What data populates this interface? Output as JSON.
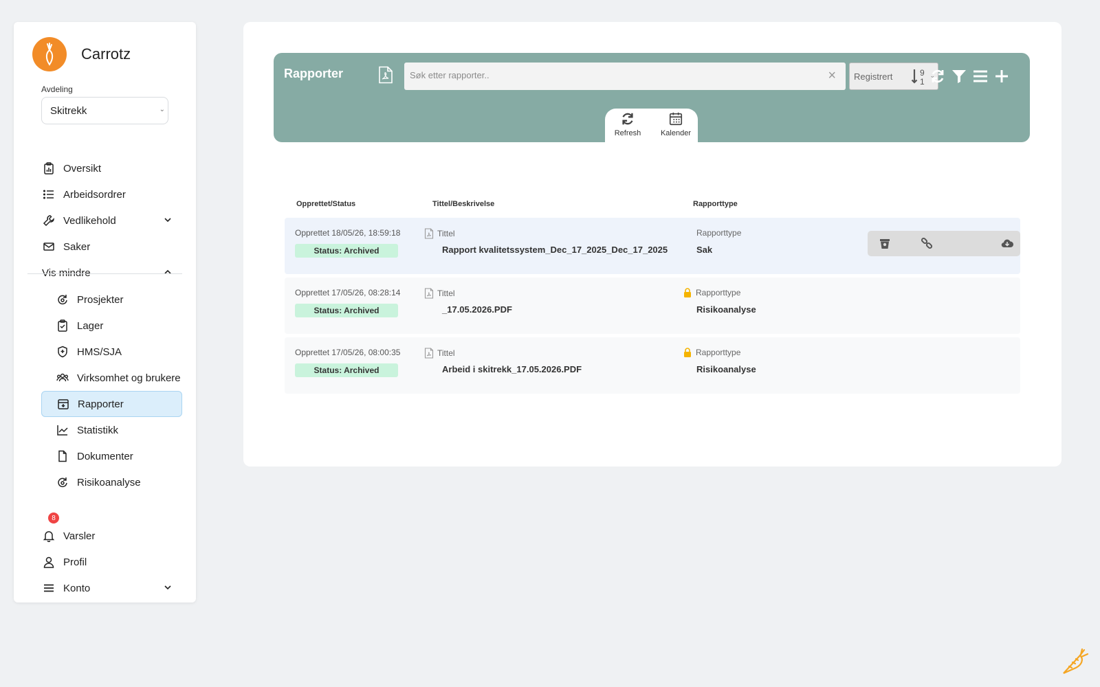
{
  "app": {
    "brand_name": "Carrotz"
  },
  "sidebar": {
    "department_label": "Avdeling",
    "department_value": "Skitrekk",
    "nav": [
      {
        "label": "Oversikt",
        "icon": "clipboard-chart-icon"
      },
      {
        "label": "Arbeidsordrer",
        "icon": "list-icon"
      },
      {
        "label": "Vedlikehold",
        "icon": "wrench-icon"
      },
      {
        "label": "Saker",
        "icon": "mail-icon"
      },
      {
        "label": "Vis mindre",
        "icon": "chevron-up-icon"
      }
    ],
    "sub_nav": [
      {
        "label": "Prosjekter",
        "icon": "project-cycle-icon"
      },
      {
        "label": "Lager",
        "icon": "clipboard-check-icon"
      },
      {
        "label": "HMS/SJA",
        "icon": "shield-plus-icon"
      },
      {
        "label": "Virksomhet og brukere",
        "icon": "users-icon"
      },
      {
        "label": "Rapporter",
        "icon": "inbox-download-icon"
      },
      {
        "label": "Statistikk",
        "icon": "line-chart-icon"
      },
      {
        "label": "Dokumenter",
        "icon": "document-icon"
      },
      {
        "label": "Risikoanalyse",
        "icon": "risk-cycle-icon"
      }
    ],
    "bottom_nav": [
      {
        "label": "Varsler",
        "icon": "bell-icon"
      },
      {
        "label": "Profil",
        "icon": "user-icon"
      },
      {
        "label": "Konto",
        "icon": "menu-icon"
      }
    ],
    "notification_count": "8"
  },
  "header": {
    "title": "Rapporter",
    "search_placeholder": "Søk etter rapporter..",
    "clear_symbol": "×",
    "sort_label": "Registrert",
    "sort_top": "9",
    "sort_bottom": "1",
    "tabs": [
      {
        "label": "Refresh"
      },
      {
        "label": "Kalender"
      }
    ]
  },
  "table": {
    "columns": [
      "Opprettet/Status",
      "Tittel/Beskrivelse",
      "Rapporttype"
    ],
    "rows": [
      {
        "created": "Opprettet 18/05/26, 18:59:18",
        "status": "Status: Archived",
        "title_label": "Tittel",
        "title": "Rapport kvalitetssystem_Dec_17_2025_Dec_17_2025",
        "type_label": "Rapporttype",
        "type": "Sak"
      },
      {
        "created": "Opprettet 17/05/26, 08:28:14",
        "status": "Status: Archived",
        "title_label": "Tittel",
        "title": "_17.05.2026.PDF",
        "type_label": "Rapporttype",
        "type": "Risikoanalyse"
      },
      {
        "created": "Opprettet 17/05/26, 08:00:35",
        "status": "Status: Archived",
        "title_label": "Tittel",
        "title": "Arbeid i skitrekk_17.05.2026.PDF",
        "type_label": "Rapporttype",
        "type": "Risikoanalyse"
      }
    ]
  },
  "colors": {
    "brand_orange": "#f28c28",
    "header_green": "#86aba4",
    "status_green": "#c9f3dc",
    "active_blue": "#dbeefb",
    "badge_red": "#ef4444",
    "lock_yellow": "#f5b400"
  }
}
